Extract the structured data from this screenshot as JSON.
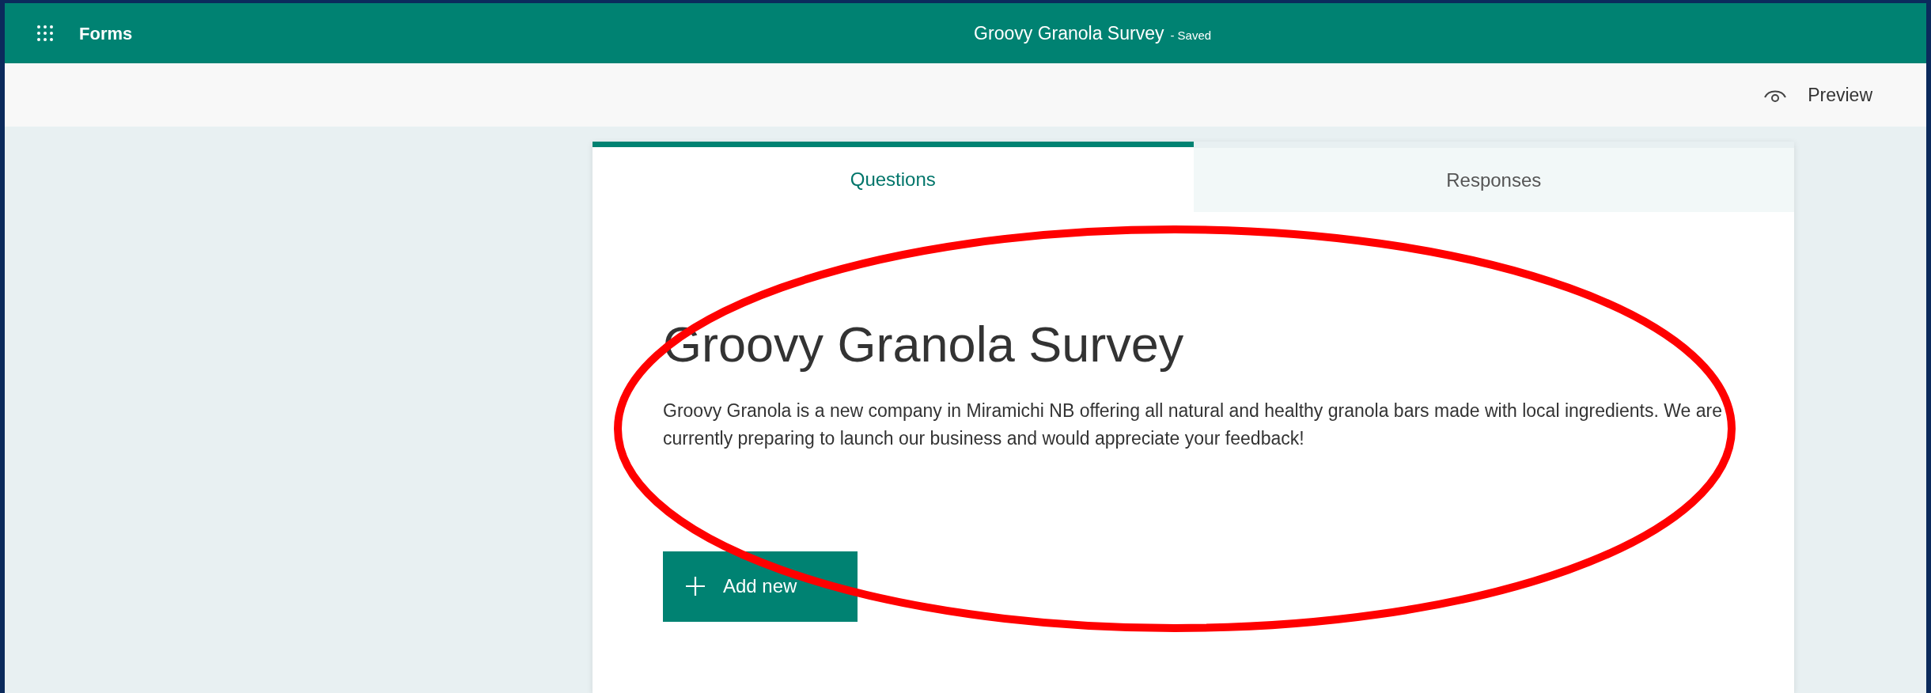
{
  "app_bar": {
    "app_name": "Forms",
    "form_title": "Groovy Granola Survey",
    "save_status": "- Saved"
  },
  "toolbar": {
    "preview": "Preview"
  },
  "tabs": [
    {
      "label": "Questions",
      "selected": true
    },
    {
      "label": "Responses",
      "selected": false
    }
  ],
  "form": {
    "title": "Groovy Granola Survey",
    "description": "Groovy Granola is a new company in Miramichi NB offering all natural and healthy granola bars made with local ingredients. We are currently preparing to launch our business and would appreciate your feedback!"
  },
  "add_button": {
    "label": "Add new"
  }
}
